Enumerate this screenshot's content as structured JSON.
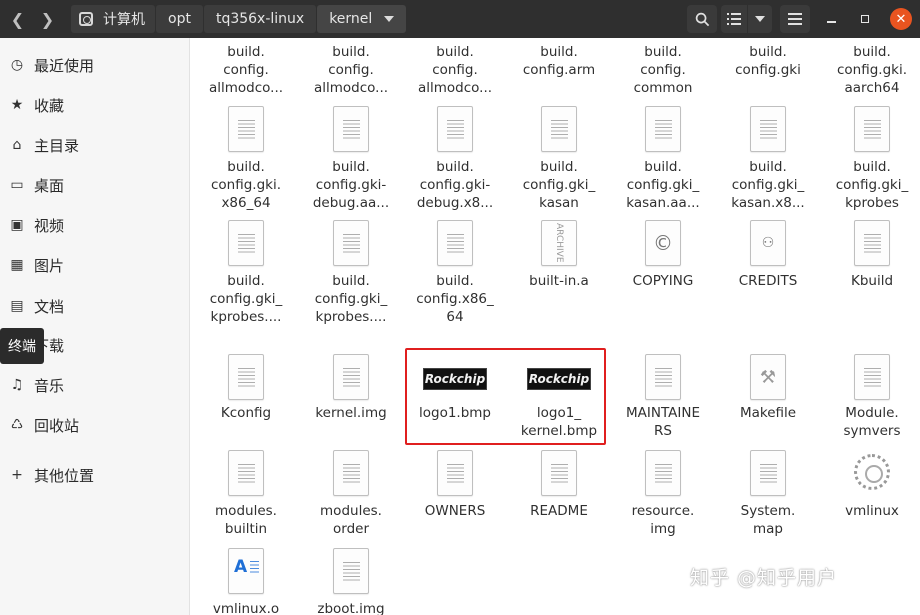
{
  "header": {
    "back_icon": "chevron-left-icon",
    "forward_icon": "chevron-right-icon",
    "breadcrumbs": [
      "计算机",
      "opt",
      "tq356x-linux",
      "kernel"
    ],
    "buttons": [
      "search-icon",
      "list-view-icon",
      "view-options-icon",
      "menu-icon",
      "minimize-icon",
      "maximize-icon",
      "close-icon"
    ]
  },
  "sidebar": {
    "items": [
      {
        "icon": "clock-icon",
        "label": "最近使用"
      },
      {
        "icon": "star-icon",
        "label": "收藏"
      },
      {
        "icon": "home-icon",
        "label": "主目录"
      },
      {
        "icon": "desktop-icon",
        "label": "桌面"
      },
      {
        "icon": "video-icon",
        "label": "视频"
      },
      {
        "icon": "image-icon",
        "label": "图片"
      },
      {
        "icon": "document-icon",
        "label": "文档"
      },
      {
        "icon": "download-icon",
        "label": "下载"
      },
      {
        "icon": "music-icon",
        "label": "音乐"
      },
      {
        "icon": "trash-icon",
        "label": "回收站"
      },
      {
        "icon": "plus-icon",
        "label": "其他位置"
      }
    ],
    "tooltip": "终端"
  },
  "files": [
    {
      "name": "build.\nconfig.\nallmodco...",
      "icon": "none"
    },
    {
      "name": "build.\nconfig.\nallmodco...",
      "icon": "none"
    },
    {
      "name": "build.\nconfig.\nallmodco...",
      "icon": "none"
    },
    {
      "name": "build.\nconfig.arm",
      "icon": "none"
    },
    {
      "name": "build.\nconfig.\ncommon",
      "icon": "none"
    },
    {
      "name": "build.\nconfig.gki",
      "icon": "none"
    },
    {
      "name": "build.\nconfig.gki.\naarch64",
      "icon": "none"
    },
    {
      "name": "build.\nconfig.gki.\nx86_64",
      "icon": "text"
    },
    {
      "name": "build.\nconfig.gki-\ndebug.aa...",
      "icon": "text"
    },
    {
      "name": "build.\nconfig.gki-\ndebug.x8...",
      "icon": "text"
    },
    {
      "name": "build.\nconfig.gki_\nkasan",
      "icon": "text"
    },
    {
      "name": "build.\nconfig.gki_\nkasan.aa...",
      "icon": "text"
    },
    {
      "name": "build.\nconfig.gki_\nkasan.x8...",
      "icon": "text"
    },
    {
      "name": "build.\nconfig.gki_\nkprobes",
      "icon": "text"
    },
    {
      "name": "build.\nconfig.gki_\nkprobes....",
      "icon": "text"
    },
    {
      "name": "build.\nconfig.gki_\nkprobes....",
      "icon": "text"
    },
    {
      "name": "build.\nconfig.x86_\n64",
      "icon": "text"
    },
    {
      "name": "built-in.a",
      "icon": "archive"
    },
    {
      "name": "COPYING",
      "icon": "copyright"
    },
    {
      "name": "CREDITS",
      "icon": "people"
    },
    {
      "name": "Kbuild",
      "icon": "text"
    },
    {
      "name": "Kconfig",
      "icon": "text"
    },
    {
      "name": "kernel.img",
      "icon": "text"
    },
    {
      "name": "logo1.bmp",
      "icon": "bmp",
      "thumb_text": "Rockchip"
    },
    {
      "name": "logo1_\nkernel.bmp",
      "icon": "bmp",
      "thumb_text": "Rockchip"
    },
    {
      "name": "MAINTAINE\nRS",
      "icon": "text"
    },
    {
      "name": "Makefile",
      "icon": "makefile"
    },
    {
      "name": "Module.\nsymvers",
      "icon": "text"
    },
    {
      "name": "modules.\nbuiltin",
      "icon": "text"
    },
    {
      "name": "modules.\norder",
      "icon": "text"
    },
    {
      "name": "OWNERS",
      "icon": "text"
    },
    {
      "name": "README",
      "icon": "text"
    },
    {
      "name": "resource.\nimg",
      "icon": "text"
    },
    {
      "name": "System.\nmap",
      "icon": "text"
    },
    {
      "name": "vmlinux",
      "icon": "gear"
    },
    {
      "name": "vmlinux.o",
      "icon": "az"
    },
    {
      "name": "zboot.img",
      "icon": "text"
    }
  ],
  "watermark": "知乎 @知乎用户"
}
